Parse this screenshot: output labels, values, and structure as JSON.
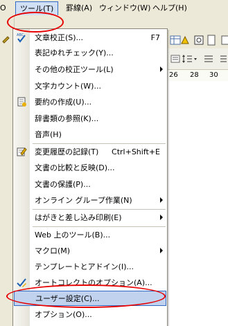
{
  "menubar": {
    "left_fragment": "O",
    "tools": "ツール(T)",
    "border": "罫線(A)",
    "window": "ウィンドウ(W)",
    "help": "ヘルプ(H)"
  },
  "ruler": {
    "n1": "26",
    "n2": "28",
    "n3": "30"
  },
  "menu": {
    "items": [
      {
        "label": "文章校正(S)...",
        "shortcut": "F7",
        "icon": "abc-check-icon"
      },
      {
        "label": "表記ゆれチェック(Y)..."
      },
      {
        "label": "その他の校正ツール(L)",
        "submenu": true
      },
      {
        "label": "文字カウント(W)..."
      },
      {
        "label": "要約の作成(U)...",
        "icon": "summary-icon"
      },
      {
        "label": "辞書類の参照(K)..."
      },
      {
        "label": "音声(H)"
      },
      {
        "label": "変更履歴の記録(T)",
        "shortcut": "Ctrl+Shift+E",
        "icon": "track-changes-icon"
      },
      {
        "label": "文書の比較と反映(D)..."
      },
      {
        "label": "文書の保護(P)..."
      },
      {
        "label": "オンライン グループ作業(N)",
        "submenu": true
      },
      {
        "label": "はがきと差し込み印刷(E)",
        "submenu": true
      },
      {
        "label": "Web 上のツール(B)..."
      },
      {
        "label": "マクロ(M)",
        "submenu": true
      },
      {
        "label": "テンプレートとアドイン(I)..."
      },
      {
        "label": "オートコレクトのオプション(A)...",
        "icon": "autocorrect-icon"
      },
      {
        "label": "ユーザー設定(C)...",
        "highlighted": true
      },
      {
        "label": "オプション(O)..."
      }
    ]
  },
  "colors": {
    "highlight": "#c1d2ee",
    "annotation": "#e60000"
  }
}
